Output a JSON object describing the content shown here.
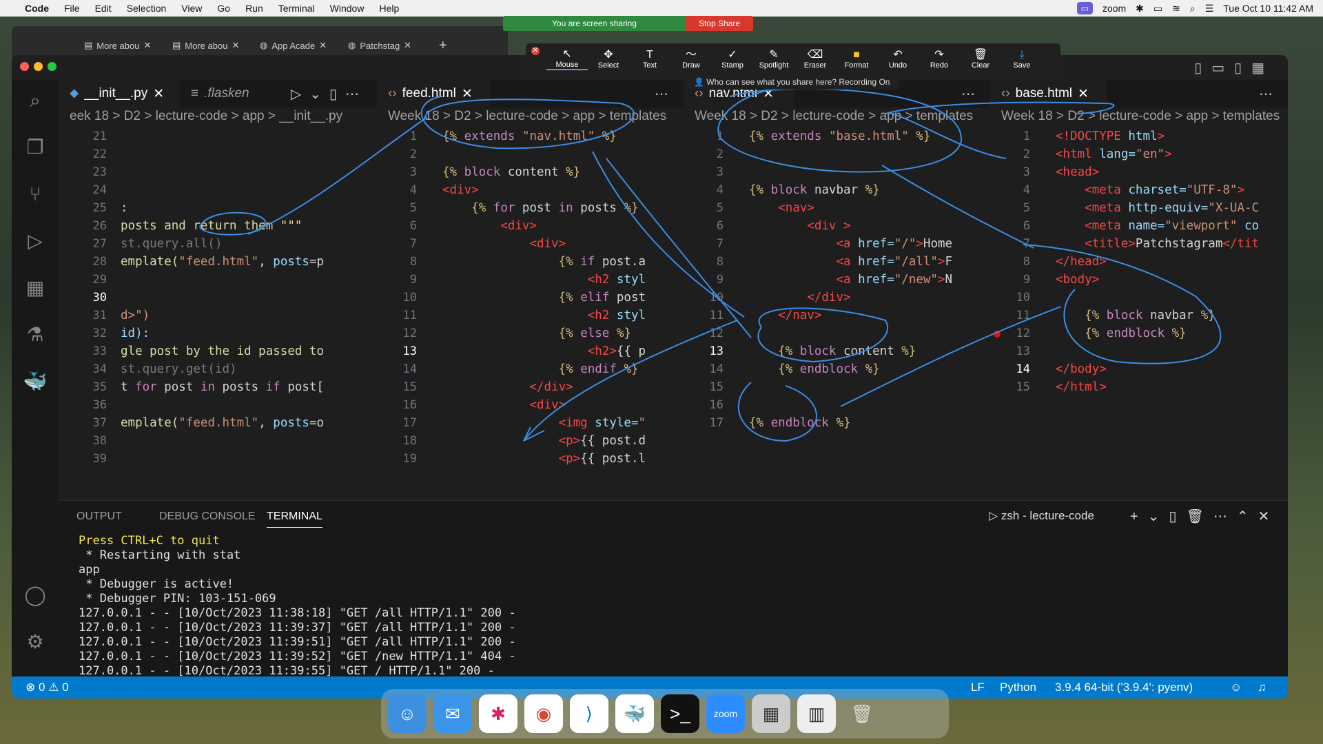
{
  "menubar": {
    "app": "Code",
    "items": [
      "File",
      "Edit",
      "Selection",
      "View",
      "Go",
      "Run",
      "Terminal",
      "Window",
      "Help"
    ],
    "zoom_label": "zoom",
    "datetime": "Tue Oct 10  11:42 AM"
  },
  "share": {
    "status": "You are screen sharing",
    "stop": "Stop Share"
  },
  "annotate": {
    "tools": [
      {
        "icon": "mouse-icon",
        "label": "Mouse"
      },
      {
        "icon": "select-icon",
        "label": "Select"
      },
      {
        "icon": "text-icon",
        "label": "Text"
      },
      {
        "icon": "draw-icon",
        "label": "Draw"
      },
      {
        "icon": "stamp-icon",
        "label": "Stamp"
      },
      {
        "icon": "spotlight-icon",
        "label": "Spotlight"
      },
      {
        "icon": "eraser-icon",
        "label": "Eraser"
      },
      {
        "icon": "format-icon",
        "label": "Format"
      },
      {
        "icon": "undo-icon",
        "label": "Undo"
      },
      {
        "icon": "redo-icon",
        "label": "Redo"
      },
      {
        "icon": "clear-icon",
        "label": "Clear"
      },
      {
        "icon": "save-icon",
        "label": "Save"
      }
    ],
    "notice": "Who can see what you share here? Recording On"
  },
  "browser_tabs": [
    "More abou",
    "More abou",
    "App Acade",
    "Patchstag"
  ],
  "editor1": {
    "tab_active": "__init__.py",
    "tab_other": ".flasken",
    "breadcrumb": "eek 18 > D2 > lecture-code > app > __init__.py"
  },
  "editor2": {
    "tab": "feed.html",
    "breadcrumb": "Week 18 > D2 > lecture-code > app > templates"
  },
  "editor3": {
    "tab": "nav.html",
    "breadcrumb": "Week 18 > D2 > lecture-code > app > templates"
  },
  "editor4": {
    "tab": "base.html",
    "breadcrumb": "Week 18 > D2 > lecture-code > app > templates"
  },
  "panel": {
    "tabs": [
      "OUTPUT",
      "DEBUG CONSOLE",
      "TERMINAL"
    ],
    "shell": "zsh - lecture-code",
    "lines": [
      "Press CTRL+C to quit",
      " * Restarting with stat",
      "app",
      " * Debugger is active!",
      " * Debugger PIN: 103-151-069",
      "127.0.0.1 - - [10/Oct/2023 11:38:18] \"GET /all HTTP/1.1\" 200 -",
      "127.0.0.1 - - [10/Oct/2023 11:39:37] \"GET /all HTTP/1.1\" 200 -",
      "127.0.0.1 - - [10/Oct/2023 11:39:51] \"GET /all HTTP/1.1\" 200 -",
      "127.0.0.1 - - [10/Oct/2023 11:39:52] \"GET /new HTTP/1.1\" 404 -",
      "127.0.0.1 - - [10/Oct/2023 11:39:55] \"GET / HTTP/1.1\" 200 -"
    ]
  },
  "status": {
    "problems": "⊗ 0  ⚠ 0",
    "eol": "LF",
    "lang": "Python",
    "interp": "3.9.4 64-bit ('3.9.4': pyenv)"
  },
  "colors": {
    "statusbar": "#007acc",
    "share_green": "#2f8a3f",
    "share_red": "#d9382f",
    "ink": "#3a8ee6"
  }
}
